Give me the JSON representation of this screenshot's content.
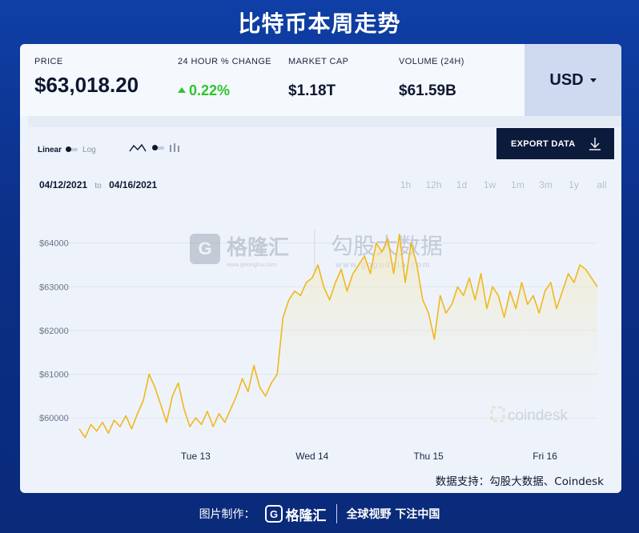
{
  "banner_title": "比特币本周走势",
  "stats": {
    "price_label": "PRICE",
    "price_value": "$63,018.20",
    "change_label": "24 HOUR % CHANGE",
    "change_value": "0.22%",
    "marketcap_label": "MARKET CAP",
    "marketcap_value": "$1.18T",
    "volume_label": "VOLUME (24H)",
    "volume_value": "$61.59B"
  },
  "currency": "USD",
  "controls": {
    "linear_label": "Linear",
    "log_label": "Log",
    "export_label": "EXPORT DATA",
    "date_from": "04/12/2021",
    "date_sep": "to",
    "date_to": "04/16/2021",
    "ranges": [
      "1h",
      "12h",
      "1d",
      "1w",
      "1m",
      "3m",
      "1y",
      "all"
    ]
  },
  "colors": {
    "line": "#f0b81b",
    "positive": "#2cc52c",
    "banner_bg": "#0f3fa6"
  },
  "watermarks": {
    "gelonghui_cn": "格隆汇",
    "gelonghui_url": "www.gelonghui.com",
    "gogudata_cn": "勾股大数据",
    "gogudata_url": "www.gogudata.com",
    "coindesk": "coindesk"
  },
  "chart_data": {
    "type": "line",
    "title": "",
    "xlabel": "",
    "ylabel": "",
    "y_ticks": [
      "$60000",
      "$61000",
      "$62000",
      "$63000",
      "$64000"
    ],
    "x_ticks": [
      "Tue 13",
      "Wed 14",
      "Thu 15",
      "Fri 16"
    ],
    "ylim": [
      59400,
      64800
    ],
    "grid": true,
    "x_tick_dates": [
      2021.13,
      2021.14,
      2021.15,
      2021.16
    ],
    "series": [
      {
        "name": "",
        "x": [
          12.0,
          12.05,
          12.1,
          12.15,
          12.2,
          12.25,
          12.3,
          12.35,
          12.4,
          12.45,
          12.5,
          12.55,
          12.6,
          12.65,
          12.7,
          12.75,
          12.8,
          12.85,
          12.9,
          12.95,
          13.0,
          13.05,
          13.1,
          13.15,
          13.2,
          13.25,
          13.3,
          13.35,
          13.4,
          13.45,
          13.5,
          13.55,
          13.6,
          13.65,
          13.7,
          13.75,
          13.8,
          13.85,
          13.9,
          13.95,
          14.0,
          14.05,
          14.1,
          14.15,
          14.2,
          14.25,
          14.3,
          14.35,
          14.4,
          14.45,
          14.5,
          14.55,
          14.6,
          14.65,
          14.7,
          14.75,
          14.8,
          14.85,
          14.9,
          14.95,
          15.0,
          15.05,
          15.1,
          15.15,
          15.2,
          15.25,
          15.3,
          15.35,
          15.4,
          15.45,
          15.5,
          15.55,
          15.6,
          15.65,
          15.7,
          15.75,
          15.8,
          15.85,
          15.9,
          15.95,
          16.0,
          16.05,
          16.1,
          16.15,
          16.2,
          16.25,
          16.3,
          16.35,
          16.4,
          16.45
        ],
        "y": [
          59750,
          59550,
          59850,
          59700,
          59900,
          59650,
          59950,
          59800,
          60050,
          59750,
          60100,
          60400,
          61000,
          60700,
          60300,
          59900,
          60500,
          60800,
          60200,
          59800,
          60000,
          59850,
          60150,
          59800,
          60100,
          59900,
          60200,
          60500,
          60900,
          60600,
          61200,
          60700,
          60500,
          60800,
          61000,
          62300,
          62700,
          62900,
          62800,
          63100,
          63200,
          63500,
          63000,
          62700,
          63100,
          63400,
          62900,
          63300,
          63500,
          63700,
          63300,
          64000,
          63800,
          64100,
          63300,
          64200,
          63100,
          64000,
          63500,
          62700,
          62400,
          61800,
          62800,
          62400,
          62600,
          63000,
          62800,
          63200,
          62700,
          63300,
          62500,
          63000,
          62800,
          62300,
          62900,
          62500,
          63100,
          62600,
          62800,
          62400,
          62900,
          63100,
          62500,
          62900,
          63300,
          63100,
          63500,
          63400,
          63200,
          63000
        ]
      }
    ]
  },
  "source_text": "数据支持：勾股大数据、Coindesk",
  "footer": {
    "label": "图片制作：",
    "brand": "格隆汇",
    "slogan": "全球视野 下注中国"
  }
}
